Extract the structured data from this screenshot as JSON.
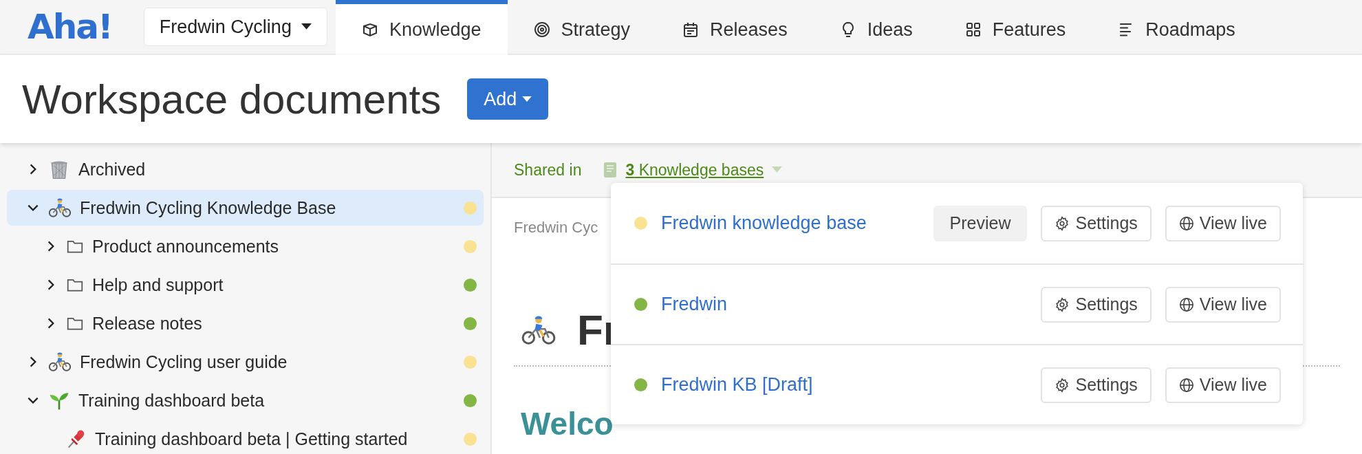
{
  "logo": "Aha!",
  "workspace": {
    "label": "Fredwin Cycling"
  },
  "tabs": [
    {
      "label": "Knowledge",
      "kind": "knowledge",
      "selected": true
    },
    {
      "label": "Strategy",
      "kind": "strategy",
      "selected": false
    },
    {
      "label": "Releases",
      "kind": "releases",
      "selected": false
    },
    {
      "label": "Ideas",
      "kind": "ideas",
      "selected": false
    },
    {
      "label": "Features",
      "kind": "features",
      "selected": false
    },
    {
      "label": "Roadmaps",
      "kind": "roadmaps",
      "selected": false
    }
  ],
  "page_title": "Workspace documents",
  "add_button": "Add",
  "sidebar": {
    "items": [
      {
        "label": "Archived",
        "kind": "archive",
        "expandable": true,
        "expanded": false,
        "selected": false
      },
      {
        "label": "Fredwin Cycling Knowledge Base",
        "kind": "knowledge_base",
        "expandable": true,
        "expanded": true,
        "selected": true,
        "color": "#f9e291",
        "children": [
          {
            "label": "Product announcements",
            "kind": "folder",
            "expandable": true,
            "expanded": false,
            "selected": false,
            "color": "#f9e291"
          },
          {
            "label": "Help and support",
            "kind": "folder",
            "expandable": true,
            "expanded": false,
            "selected": false,
            "color": "#84b645"
          },
          {
            "label": "Release notes",
            "kind": "folder",
            "expandable": true,
            "expanded": false,
            "selected": false,
            "color": "#84b645"
          }
        ]
      },
      {
        "label": "Fredwin Cycling user guide",
        "kind": "knowledge_base",
        "expandable": true,
        "expanded": false,
        "selected": false,
        "color": "#f9e291"
      },
      {
        "label": "Training dashboard beta",
        "kind": "plan",
        "expandable": true,
        "expanded": true,
        "selected": false,
        "color": "#84b645",
        "children": [
          {
            "label": "Training dashboard beta | Getting started",
            "kind": "page",
            "expandable": false,
            "selected": false,
            "color": "#f9e291"
          }
        ]
      }
    ]
  },
  "shared": {
    "label": "Shared in",
    "link": "**3** Knowledge bases"
  },
  "knowledge_bases": [
    {
      "name": "Fredwin knowledge base",
      "color": "#f9e291",
      "buttons": [
        {
          "label": "Preview",
          "kind": "preview"
        },
        {
          "label": "Settings",
          "kind": "settings"
        },
        {
          "label": "View live",
          "kind": "view_live"
        }
      ]
    },
    {
      "name": "Fredwin",
      "color": "#84b645",
      "buttons": [
        {
          "label": "Settings",
          "kind": "settings"
        },
        {
          "label": "View live",
          "kind": "view_live"
        }
      ]
    },
    {
      "name": "Fredwin KB [Draft]",
      "color": "#84b645",
      "buttons": [
        {
          "label": "Settings",
          "kind": "settings"
        },
        {
          "label": "View live",
          "kind": "view_live"
        }
      ]
    }
  ],
  "document": {
    "breadcrumb": "Fredwin Cyc",
    "title": "Fr",
    "welcome": "Welco"
  }
}
